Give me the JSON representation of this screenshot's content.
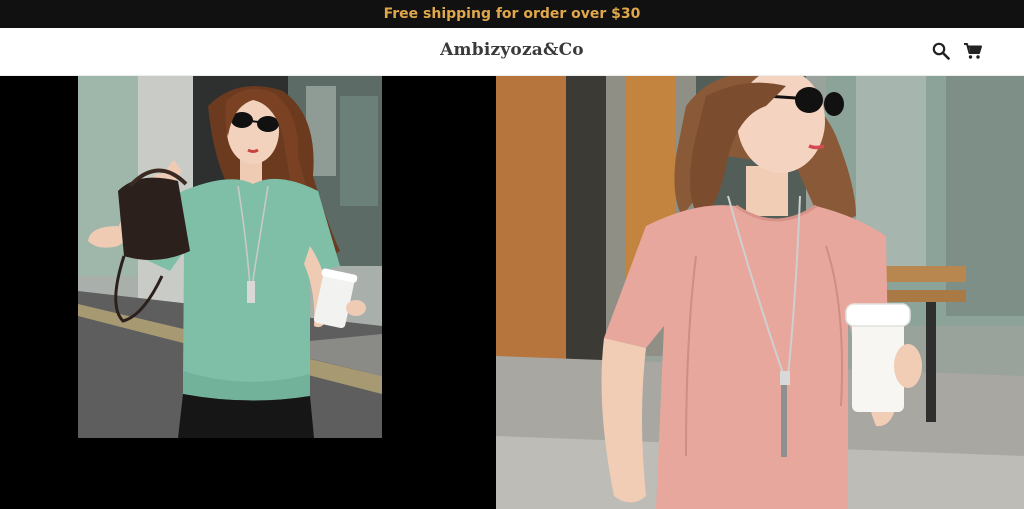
{
  "announcement": {
    "text": "Free shipping for order over $30"
  },
  "header": {
    "logo": "Ambizyoza&Co",
    "icons": [
      "search-icon",
      "cart-icon"
    ]
  },
  "hero": {
    "left_image": "woman-mint-tshirt-photo",
    "right_image": "woman-pink-tshirt-photo"
  },
  "colors": {
    "announcement_bg": "#111111",
    "announcement_text": "#e0a84a",
    "hero_bg": "#000000",
    "mint_shirt": "#7fbfa8",
    "pink_shirt": "#e7a79c"
  }
}
